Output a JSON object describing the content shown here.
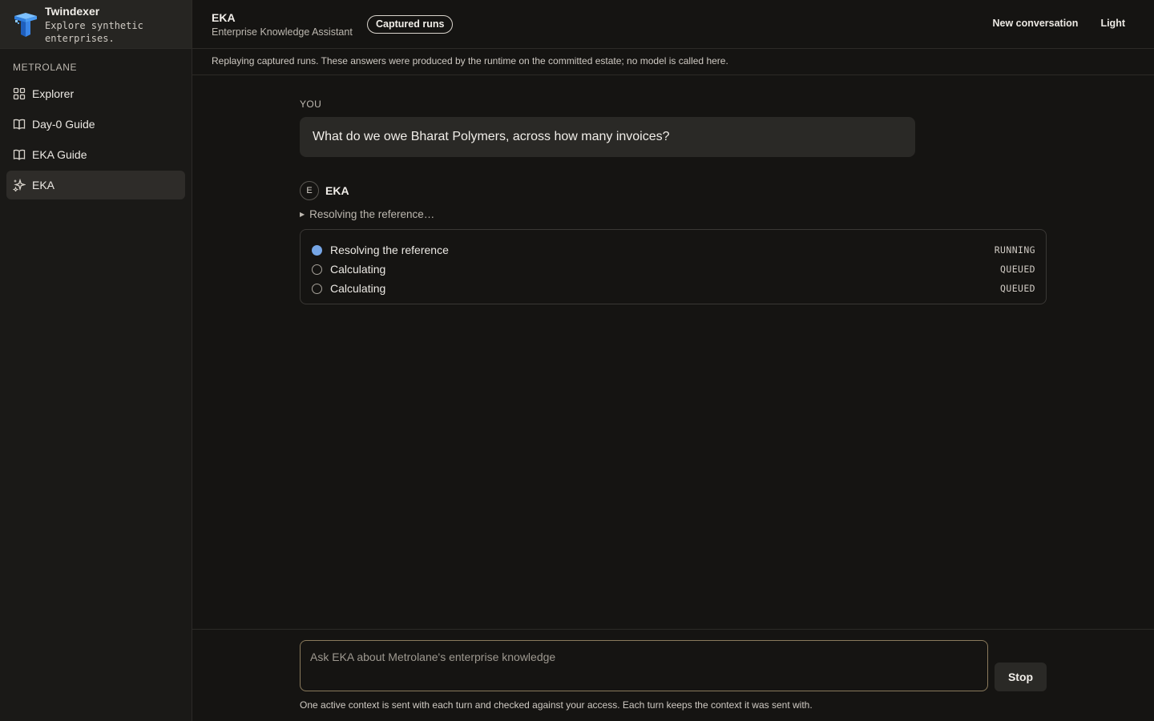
{
  "brand": {
    "name": "Twindexer",
    "tagline": "Explore synthetic enterprises."
  },
  "sidebar": {
    "section_label": "METROLANE",
    "items": [
      {
        "label": "Explorer",
        "icon": "grid-icon",
        "active": false
      },
      {
        "label": "Day-0 Guide",
        "icon": "book-icon",
        "active": false
      },
      {
        "label": "EKA Guide",
        "icon": "book-icon",
        "active": false
      },
      {
        "label": "EKA",
        "icon": "sparkle-icon",
        "active": true
      }
    ]
  },
  "header": {
    "title": "EKA",
    "subtitle": "Enterprise Knowledge Assistant",
    "badge": "Captured runs",
    "new_conversation": "New conversation",
    "theme_toggle": "Light"
  },
  "notice": "Replaying captured runs. These answers were produced by the runtime on the committed estate; no model is called here.",
  "conversation": {
    "you_label": "YOU",
    "user_message": "What do we owe Bharat Polymers, across how many invoices?",
    "assistant_avatar": "E",
    "assistant_name": "EKA",
    "status_summary": "Resolving the reference…",
    "steps": [
      {
        "label": "Resolving the reference",
        "status": "RUNNING"
      },
      {
        "label": "Calculating",
        "status": "QUEUED"
      },
      {
        "label": "Calculating",
        "status": "QUEUED"
      }
    ]
  },
  "composer": {
    "placeholder": "Ask EKA about Metrolane's enterprise knowledge",
    "stop_label": "Stop",
    "note": "One active context is sent with each turn and checked against your access. Each turn keeps the context it was sent with."
  },
  "colors": {
    "running_dot": "#76a6e6",
    "input_border": "#8a7a5c",
    "background": "#151412"
  }
}
